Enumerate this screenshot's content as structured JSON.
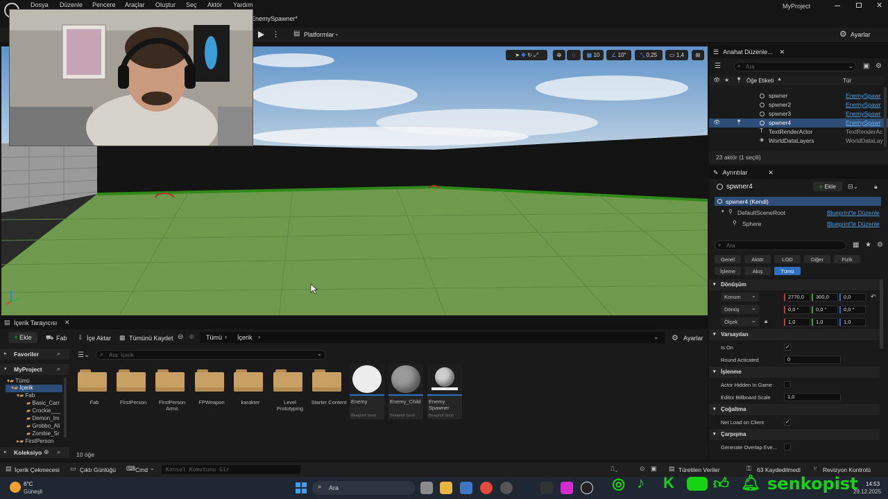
{
  "menu": {
    "items": [
      "Dosya",
      "Düzenle",
      "Pencere",
      "Araçlar",
      "Oluştur",
      "Seç",
      "Aktör",
      "Yardım"
    ],
    "tab_title": "EnemySpawner*",
    "project": "MyProject"
  },
  "toolbar": {
    "platforms": "Platformlar",
    "settings": "Ayarlar"
  },
  "viewport": {
    "grid_snap": "10",
    "rot_snap": "10°",
    "scale_snap": "0,25",
    "cam_speed": "1,4"
  },
  "outliner": {
    "tab": "Anahat Düzenle...",
    "search_placeholder": "Ara",
    "col_label": "Öğe Etiketi",
    "col_type": "Tür",
    "rows": [
      {
        "name": "spwner",
        "type": "EnemySpawr"
      },
      {
        "name": "spwner2",
        "type": "EnemySpawr"
      },
      {
        "name": "spwner3",
        "type": "EnemySpawr"
      },
      {
        "name": "spwner4",
        "type": "EnemySpawr"
      },
      {
        "name": "TextRenderActor",
        "type": "TextRenderAc"
      },
      {
        "name": "WorldDataLayers",
        "type": "WorldDataLay"
      }
    ],
    "count": "23 aktör (1 seçili)"
  },
  "details": {
    "tab": "Ayrıntılar",
    "actor_name": "spwner4",
    "add": "Ekle",
    "self_row": "spwner4 (Kendi)",
    "components": [
      {
        "name": "DefaultSceneRoot",
        "link": "Blueprint'te Düzenle"
      },
      {
        "name": "Sphere",
        "link": "Blueprint'te Düzenle"
      }
    ],
    "search_placeholder": "Ara",
    "categories": [
      "Genel",
      "Aktör",
      "LOD",
      "Diğer",
      "Fizik",
      "İşleme",
      "Akış",
      "Tümü"
    ],
    "transform_header": "Dönüşüm",
    "location_label": "Konum",
    "location": [
      "2770,0",
      "300,0",
      "0,0"
    ],
    "rotation_label": "Dönüş",
    "rotation": [
      "0,0 °",
      "0,0 °",
      "0,0 °"
    ],
    "scale_label": "Ölçek",
    "scale": [
      "1,0",
      "1,0",
      "1,0"
    ],
    "default_header": "Varsayılan",
    "is_on": "Is On",
    "round_label": "Round Acticated",
    "round_value": "0",
    "render_header": "İşlenme",
    "hidden_label": "Actor Hidden In Game",
    "billboard_label": "Editor Billboard Scale",
    "billboard_value": "1,0",
    "replication_header": "Çoğaltma",
    "net_load": "Net Load on Client",
    "collision_header": "Çarpışma",
    "gen_overlap": "Generate Overlap Eve..."
  },
  "content": {
    "tab": "İçerik Tarayıcısı",
    "add": "Ekle",
    "fab": "Fab",
    "import": "İçe Aktar",
    "save_all": "Tümünü Kaydet",
    "path": [
      "Tümü",
      "İçerik"
    ],
    "settings": "Ayarlar",
    "favorites": "Favoriler",
    "project": "MyProject",
    "search_placeholder": "Ara: İçerik",
    "tree": [
      "Tümü",
      "İçerik",
      "Fab",
      "Basic_Carr",
      "Crockie___",
      "Demon_Im",
      "Grobbo_Ali",
      "Zombie_Sr",
      "FirstPerson"
    ],
    "collections": "Koleksiyo",
    "folders": [
      "Fab",
      "FirstPerson",
      "FirstPerson Arms",
      "FPWeapon",
      "karakter",
      "Level Prototyping",
      "Starter Content"
    ],
    "assets": [
      {
        "name": "Enemy",
        "kind": "Blueprint Sınıfı"
      },
      {
        "name": "Enemy_Child",
        "kind": "Blueprint Sınıfı"
      },
      {
        "name": "Enemy Spawner",
        "kind": "Blueprint Sınıfı"
      }
    ],
    "item_count": "10 öğe"
  },
  "status": {
    "drawer": "İçerik Çekmecesi",
    "log": "Çıktı Günlüğü",
    "cmd": "Cmd",
    "console_placeholder": "Konsol Komutunu Gir",
    "derived": "Türetilen Veriler",
    "saved": "63 Kaydedilmedi",
    "revision": "Revizyon Kontrolü"
  },
  "taskbar": {
    "temp": "6°C",
    "weather": "Güneşli",
    "search": "Ara",
    "time": "14:53",
    "date": "29.12.2025",
    "overlay_name": "senkopist"
  },
  "colors": {
    "accent": "#2f6fbd",
    "selection": "#2e4e7a",
    "overlay_green": "#14d411",
    "link": "#4d9de0"
  }
}
